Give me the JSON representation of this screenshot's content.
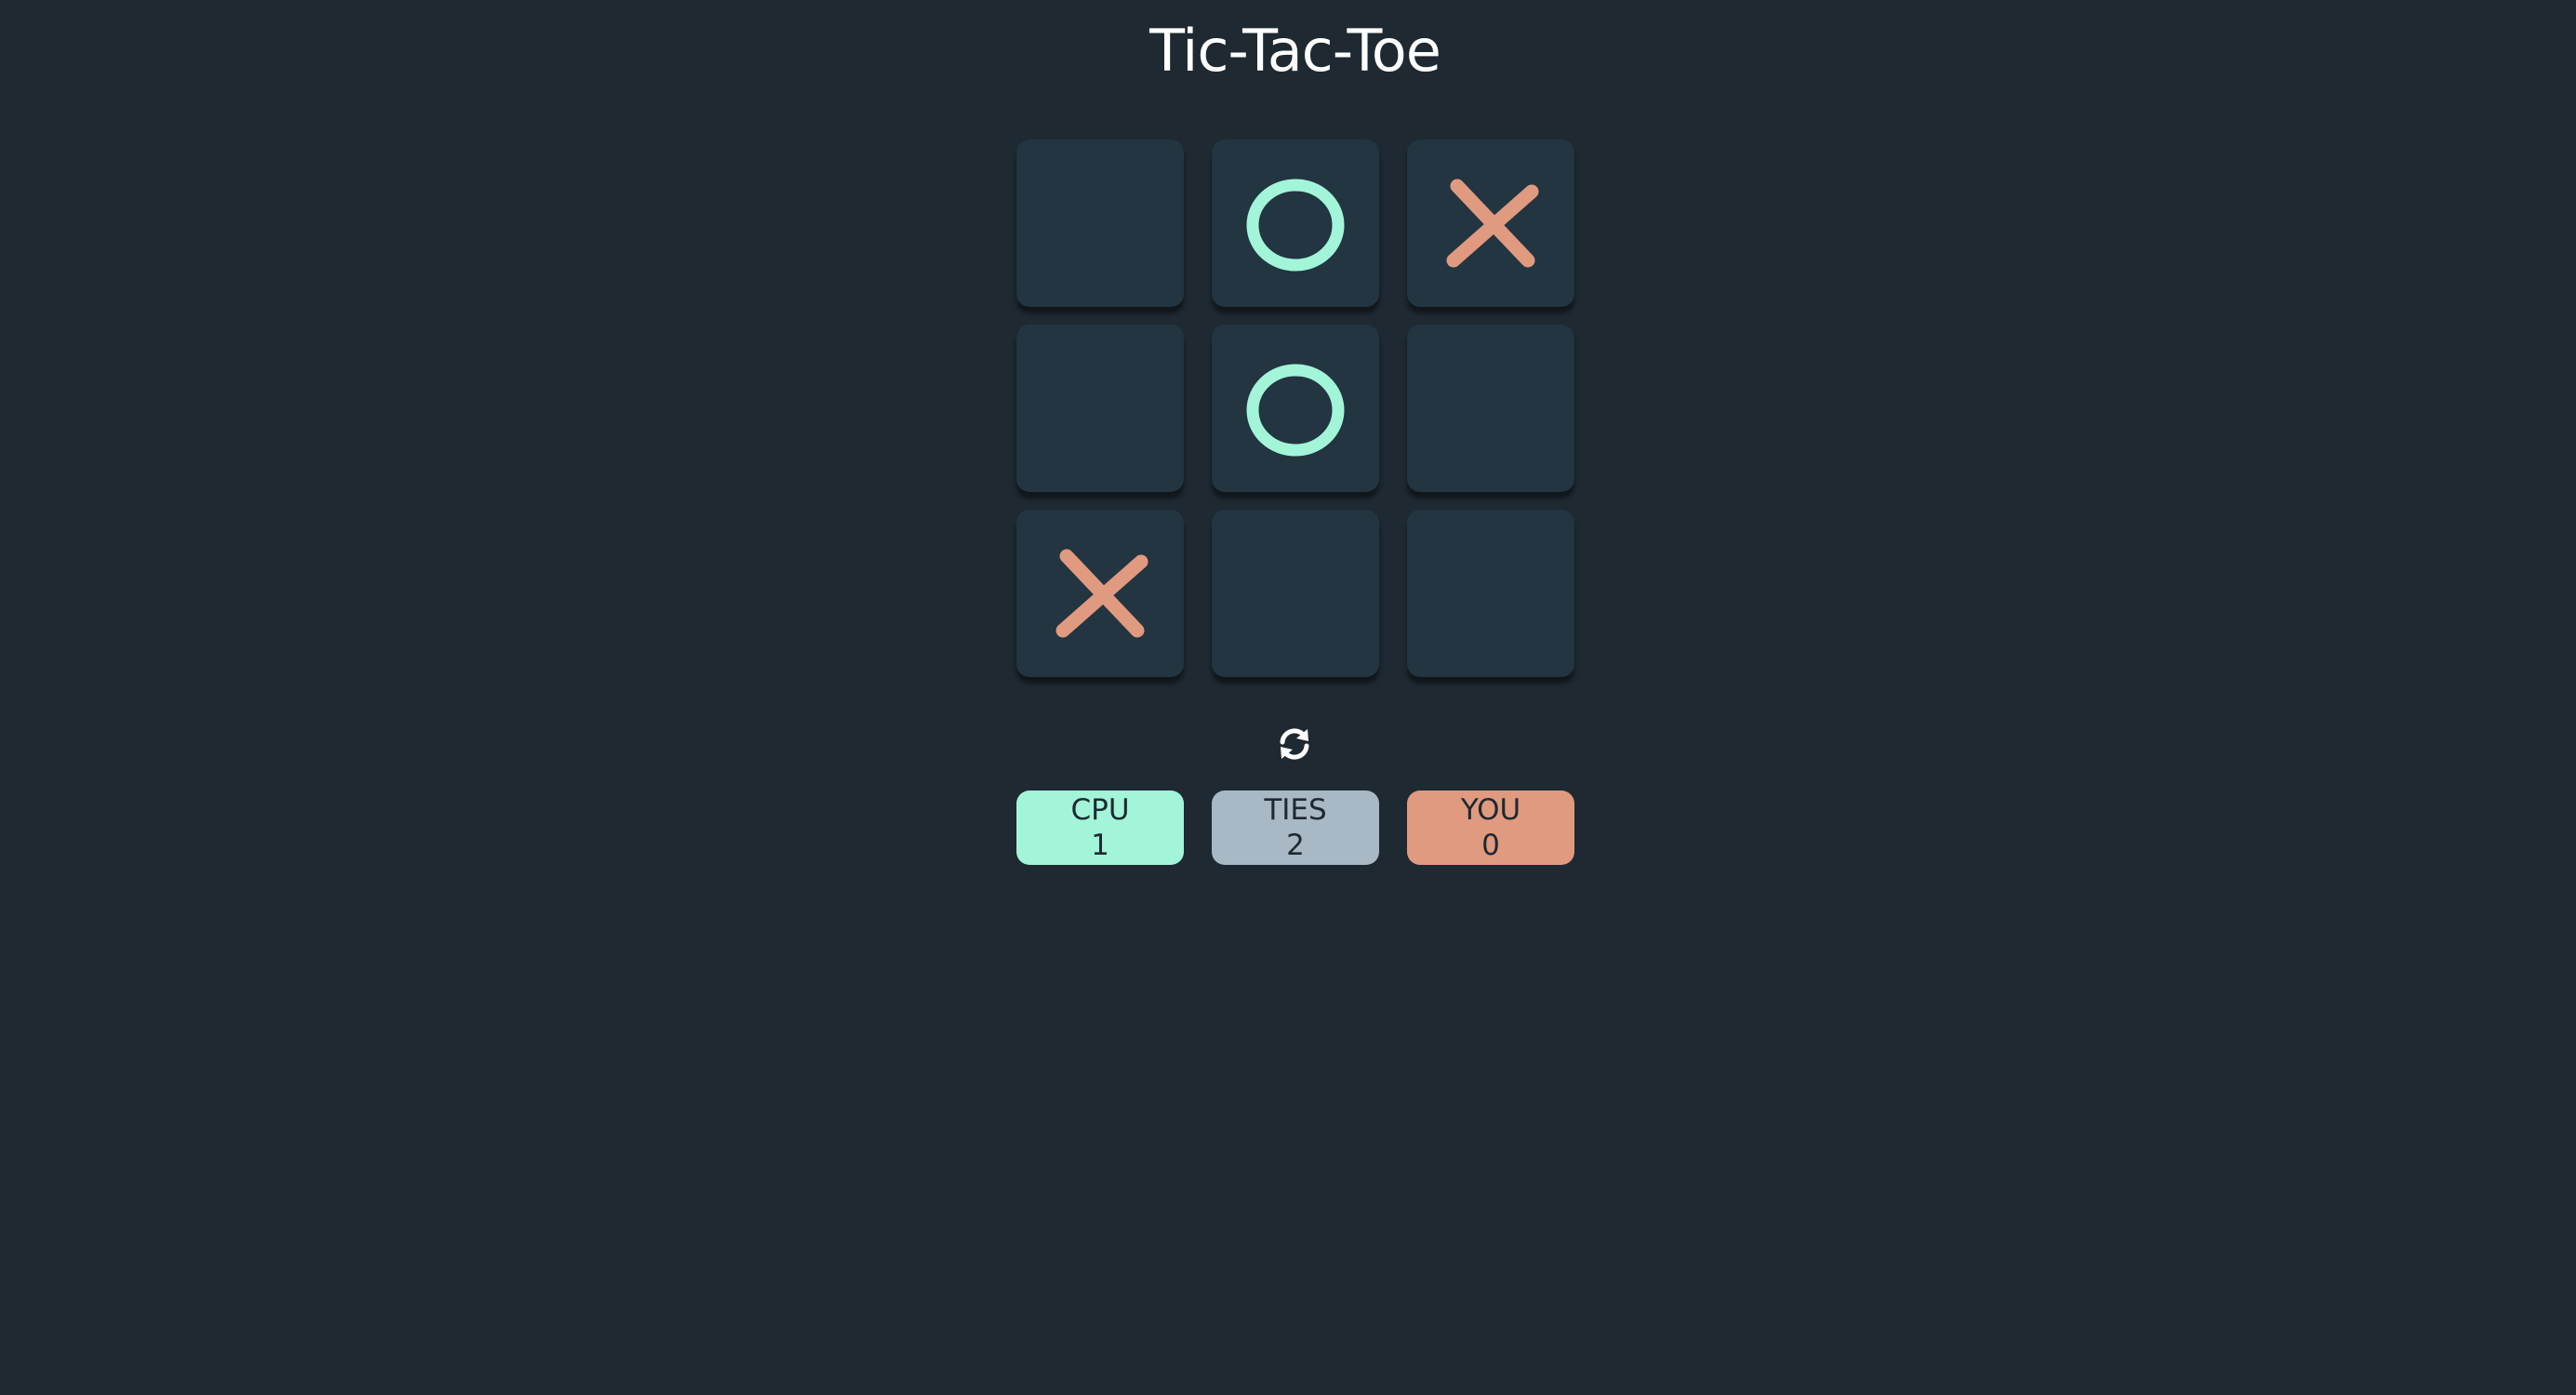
{
  "app": {
    "title": "Tic-Tac-Toe"
  },
  "colors": {
    "background": "#1e2931",
    "cell": "#223540",
    "o_mark": "#a2f5d8",
    "x_mark": "#e09a80",
    "cpu_score_bg": "#a2f5d8",
    "ties_score_bg": "#a8b8c5",
    "you_score_bg": "#e09a80"
  },
  "board": {
    "cells": [
      "",
      "O",
      "X",
      "",
      "O",
      "",
      "X",
      "",
      ""
    ]
  },
  "controls": {
    "reset_icon": "refresh-icon"
  },
  "scores": {
    "cpu": {
      "label": "CPU",
      "value": "1"
    },
    "ties": {
      "label": "TIES",
      "value": "2"
    },
    "you": {
      "label": "YOU",
      "value": "0"
    }
  }
}
